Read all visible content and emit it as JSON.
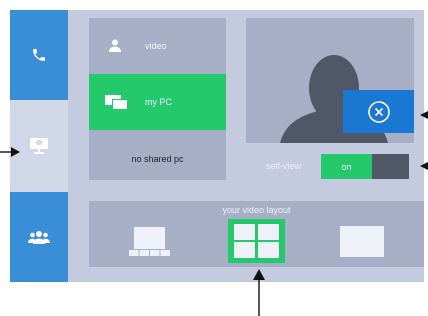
{
  "rail": {
    "items": [
      {
        "icon": "phone-icon",
        "active": true
      },
      {
        "icon": "screen-share-icon",
        "active": false
      },
      {
        "icon": "group-icon",
        "active": true
      }
    ]
  },
  "share": {
    "options": [
      {
        "label": "video",
        "icon": "person-icon"
      },
      {
        "label": "my PC",
        "icon": "pc-windows-icon",
        "selected": true
      }
    ],
    "empty_text": "no shared pc"
  },
  "video": {
    "preview_icon": "silhouette-icon",
    "close_icon": "close-circle-icon"
  },
  "self_view": {
    "label": "self-view",
    "state": "on"
  },
  "layout": {
    "title": "your video layout",
    "options": [
      {
        "icon": "layout-filmstrip-icon"
      },
      {
        "icon": "layout-grid-icon",
        "selected": true
      },
      {
        "icon": "layout-single-icon"
      }
    ]
  },
  "colors": {
    "accent_blue": "#3a8ed8",
    "selected_green": "#23c96b",
    "panel_bg": "#c4cbde",
    "card_bg": "#a7afc6"
  }
}
